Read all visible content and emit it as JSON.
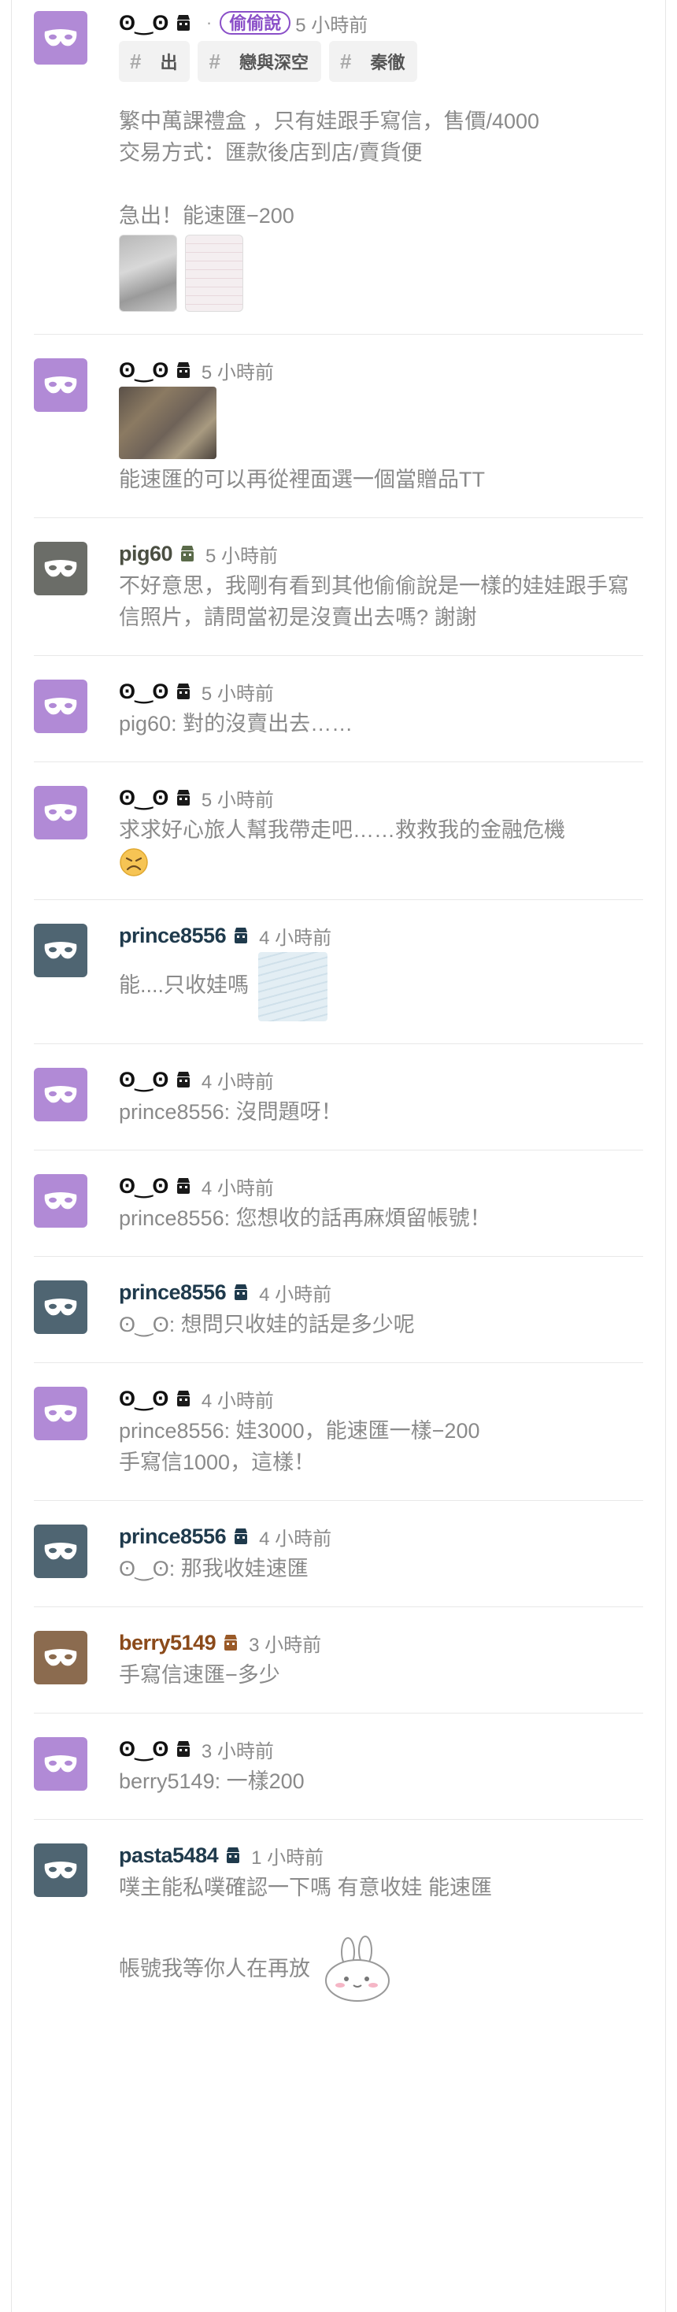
{
  "colors": {
    "purple": "#b18ad6",
    "slate": "#4f6572",
    "gray": "#6b6d68",
    "brown": "#8b6b4f",
    "pill": "#8a4fc8"
  },
  "post0": {
    "author": "ʘ‿ʘ",
    "tag_label": "偷偷說",
    "time": "5 小時前",
    "tags": [
      "出",
      "戀與深空",
      "秦徹"
    ],
    "text": "繁中萬課禮盒 ，只有娃跟手寫信，售價/4000\n交易方式：匯款後店到店/賣貨便\n\n急出！能速匯−200"
  },
  "comments": [
    {
      "author": "ʘ‿ʘ",
      "time": "5 小時前",
      "text": "能速匯的可以再從裡面選一個當贈品TT"
    },
    {
      "author": "pig60",
      "time": "5 小時前",
      "text": "不好意思，我剛有看到其他偷偷說是一樣的娃娃跟手寫信照片，請問當初是沒賣出去嗎? 謝謝"
    },
    {
      "author": "ʘ‿ʘ",
      "time": "5 小時前",
      "text": "pig60: 對的沒賣出去……"
    },
    {
      "author": "ʘ‿ʘ",
      "time": "5 小時前",
      "text": "求求好心旅人幫我帶走吧……救救我的金融危機"
    },
    {
      "author": "prince8556",
      "time": "4 小時前",
      "text": "能....只收娃嗎"
    },
    {
      "author": "ʘ‿ʘ",
      "time": "4 小時前",
      "text": "prince8556: 沒問題呀！"
    },
    {
      "author": "ʘ‿ʘ",
      "time": "4 小時前",
      "text": "prince8556: 您想收的話再麻煩留帳號！"
    },
    {
      "author": "prince8556",
      "time": "4 小時前",
      "text": "ʘ‿ʘ: 想問只收娃的話是多少呢"
    },
    {
      "author": "ʘ‿ʘ",
      "time": "4 小時前",
      "text": "prince8556: 娃3000，能速匯一樣−200\n手寫信1000，這樣！"
    },
    {
      "author": "prince8556",
      "time": "4 小時前",
      "text": "ʘ‿ʘ: 那我收娃速匯"
    },
    {
      "author": "berry5149",
      "time": "3 小時前",
      "text": "手寫信速匯−多少"
    },
    {
      "author": "ʘ‿ʘ",
      "time": "3 小時前",
      "text": "berry5149: 一樣200"
    },
    {
      "author": "pasta5484",
      "time": "1 小時前",
      "text": "噗主能私噗確認一下嗎 有意收娃 能速匯\n\n帳號我等你人在再放"
    }
  ]
}
